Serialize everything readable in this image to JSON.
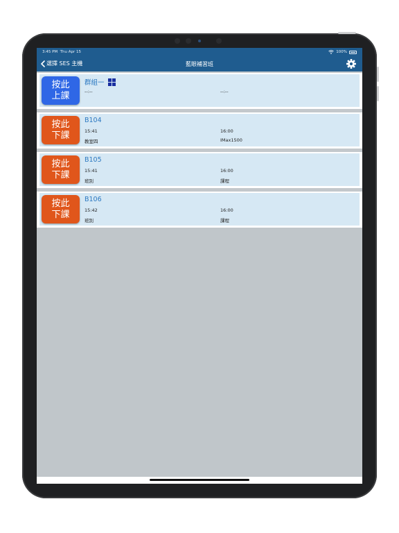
{
  "status_bar": {
    "time": "3:45 PM",
    "date": "Thu Apr 15",
    "battery": "100%"
  },
  "nav": {
    "back_label": "選擇 SES 主機",
    "title": "藍眼補習班"
  },
  "rows": [
    {
      "button_line1": "按此",
      "button_line2": "上課",
      "button_color": "#2f67e6",
      "name": "群組一",
      "start": "--:--",
      "end": "--:--",
      "left_sub": "",
      "right_sub": "",
      "has_grid_icon": true
    },
    {
      "button_line1": "按此",
      "button_line2": "下課",
      "button_color": "#e0561b",
      "name": "B104",
      "start": "15:41",
      "end": "16:00",
      "left_sub": "教室四",
      "right_sub": "IMax1500",
      "has_grid_icon": false
    },
    {
      "button_line1": "按此",
      "button_line2": "下課",
      "button_color": "#e0561b",
      "name": "B105",
      "start": "15:41",
      "end": "16:00",
      "left_sub": "班別",
      "right_sub": "課程",
      "has_grid_icon": false
    },
    {
      "button_line1": "按此",
      "button_line2": "下課",
      "button_color": "#e0561b",
      "name": "B106",
      "start": "15:42",
      "end": "16:00",
      "left_sub": "班別",
      "right_sub": "課程",
      "has_grid_icon": false
    }
  ],
  "colors": {
    "nav_bar": "#1f5c8f",
    "name_text": "#2c79c1",
    "card_bg": "#d6e8f4",
    "empty_area": "#c0c6ca"
  }
}
